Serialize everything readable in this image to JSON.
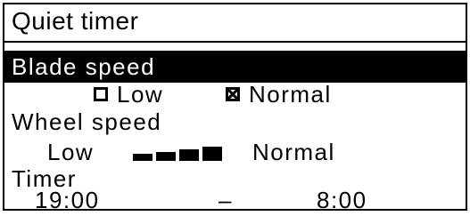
{
  "title": "Quiet timer",
  "blade_speed": {
    "label": "Blade speed",
    "options": [
      {
        "label": "Low",
        "checked": false
      },
      {
        "label": "Normal",
        "checked": true
      }
    ]
  },
  "wheel_speed": {
    "label": "Wheel speed",
    "min_label": "Low",
    "max_label": "Normal",
    "level": 4,
    "max_level": 4
  },
  "timer": {
    "label": "Timer",
    "start": "19:00",
    "separator": "–",
    "end": "8:00"
  }
}
